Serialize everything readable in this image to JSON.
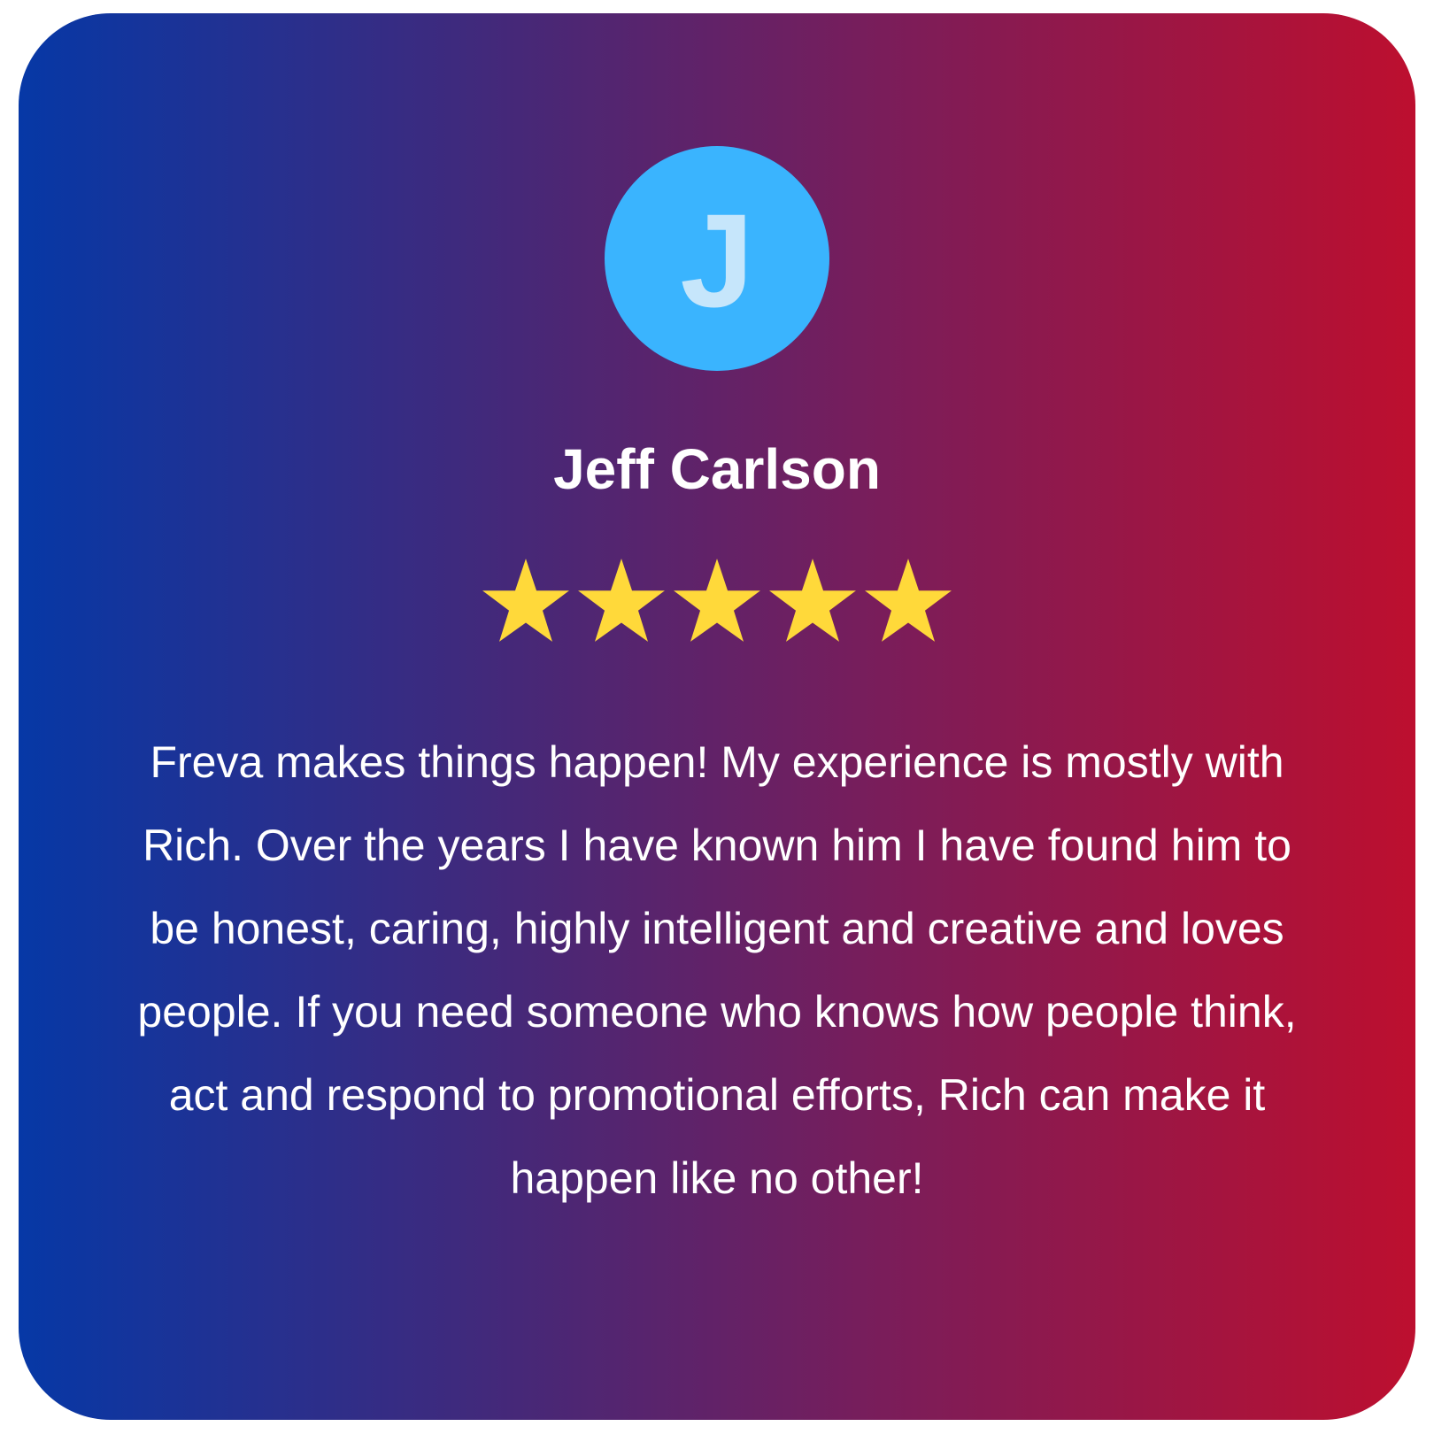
{
  "review": {
    "avatar_initial": "J",
    "reviewer_name": "Jeff Carlson",
    "rating": 5,
    "rating_max": 5,
    "text": "Freva makes things happen! My experience is mostly with Rich. Over the years I have known him I have found him to be honest, caring, highly intelligent and creative and loves people. If you need someone who knows how people think, act and respond to promotional efforts, Rich can make it happen like no other!"
  },
  "colors": {
    "gradient_start": "#0638a6",
    "gradient_end": "#bd0f2f",
    "avatar_bg": "#3ab4fe",
    "avatar_letter": "#c6e6fb",
    "star": "#ffd93a",
    "text": "#ffffff"
  },
  "icons": {
    "rating_star": "star-icon"
  }
}
